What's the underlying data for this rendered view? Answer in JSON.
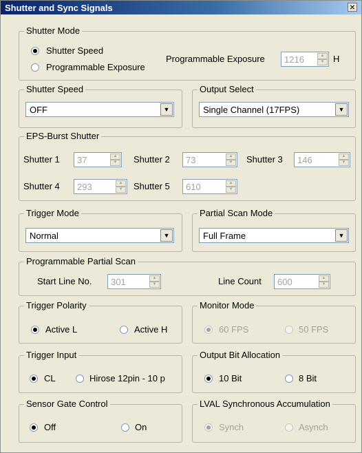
{
  "window": {
    "title": "Shutter and Sync Signals",
    "close_label": "✕"
  },
  "shutter_mode": {
    "legend": "Shutter Mode",
    "options": [
      "Shutter Speed",
      "Programmable Exposure"
    ],
    "selected": "Shutter Speed",
    "exposure_label": "Programmable Exposure",
    "exposure_value": "1216",
    "exposure_unit": "H"
  },
  "shutter_speed": {
    "legend": "Shutter Speed",
    "value": "OFF"
  },
  "output_select": {
    "legend": "Output Select",
    "value": "Single Channel (17FPS)"
  },
  "eps_burst": {
    "legend": "EPS-Burst Shutter",
    "shutters": [
      {
        "label": "Shutter 1",
        "value": "37"
      },
      {
        "label": "Shutter 2",
        "value": "73"
      },
      {
        "label": "Shutter 3",
        "value": "146"
      },
      {
        "label": "Shutter 4",
        "value": "293"
      },
      {
        "label": "Shutter 5",
        "value": "610"
      }
    ]
  },
  "trigger_mode": {
    "legend": "Trigger Mode",
    "value": "Normal"
  },
  "partial_scan_mode": {
    "legend": "Partial Scan Mode",
    "value": "Full Frame"
  },
  "prog_partial_scan": {
    "legend": "Programmable Partial Scan",
    "start_label": "Start Line No.",
    "start_value": "301",
    "count_label": "Line Count",
    "count_value": "600"
  },
  "trigger_polarity": {
    "legend": "Trigger Polarity",
    "options": [
      "Active L",
      "Active H"
    ],
    "selected": "Active L"
  },
  "monitor_mode": {
    "legend": "Monitor Mode",
    "options": [
      "60 FPS",
      "50 FPS"
    ],
    "selected": "60 FPS"
  },
  "trigger_input": {
    "legend": "Trigger Input",
    "options": [
      "CL",
      "Hirose 12pin - 10 p"
    ],
    "selected": "CL"
  },
  "output_bit": {
    "legend": "Output Bit Allocation",
    "options": [
      "10 Bit",
      "8 Bit"
    ],
    "selected": "10 Bit"
  },
  "sensor_gate": {
    "legend": "Sensor Gate Control",
    "options": [
      "Off",
      "On"
    ],
    "selected": "Off"
  },
  "lval_sync": {
    "legend": "LVAL Synchronous Accumulation",
    "options": [
      "Synch",
      "Asynch"
    ],
    "selected": "Synch"
  },
  "colors": {
    "title_bar": "#0a246a",
    "dialog_bg": "#ece9d8",
    "disabled_text": "#a3a299"
  }
}
